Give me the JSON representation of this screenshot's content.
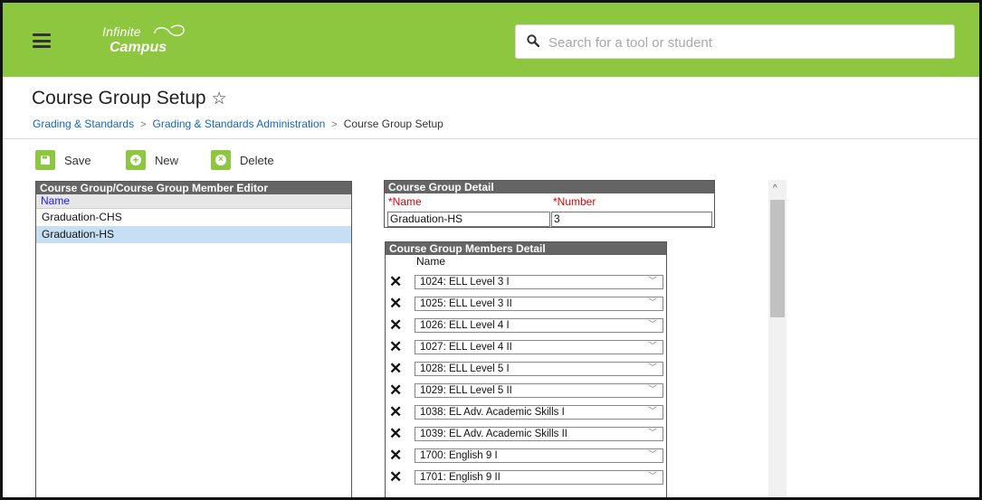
{
  "header": {
    "logo_line1": "Infinite",
    "logo_line2": "Campus",
    "search_placeholder": "Search for a tool or student",
    "brand_color": "#8dc63f"
  },
  "page": {
    "title": "Course Group Setup",
    "breadcrumbs": [
      "Grading & Standards",
      "Grading & Standards Administration",
      "Course Group Setup"
    ]
  },
  "toolbar": {
    "save_label": "Save",
    "new_label": "New",
    "delete_label": "Delete"
  },
  "editor": {
    "header": "Course Group/Course Group Member Editor",
    "column": "Name",
    "rows": [
      "Graduation-CHS",
      "Graduation-HS"
    ],
    "selected_index": 1
  },
  "detail": {
    "header": "Course Group Detail",
    "name_label": "*Name",
    "number_label": "*Number",
    "name_value": "Graduation-HS",
    "number_value": "3"
  },
  "members": {
    "header": "Course Group Members Detail",
    "column": "Name",
    "rows": [
      "1024: ELL Level 3 I",
      "1025: ELL Level 3 II",
      "1026: ELL Level 4 I",
      "1027: ELL Level 4 II",
      "1028: ELL Level 5 I",
      "1029: ELL Level 5 II",
      "1038: EL Adv. Academic Skills I",
      "1039: EL Adv. Academic Skills II",
      "1700: English 9 I",
      "1701: English 9 II"
    ]
  }
}
